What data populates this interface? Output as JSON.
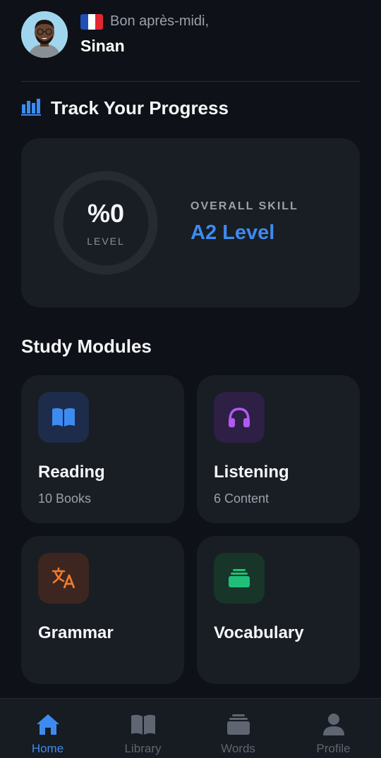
{
  "header": {
    "greeting": "Bon après-midi,",
    "username": "Sinan",
    "flag": "france-flag-icon"
  },
  "progress": {
    "title": "Track Your Progress",
    "ring_value": "%0",
    "ring_label": "LEVEL",
    "ring_percent": 0,
    "skill_label": "OVERALL SKILL",
    "skill_value": "A2 Level"
  },
  "modules": {
    "title": "Study Modules",
    "items": [
      {
        "name": "Reading",
        "subtitle": "10 Books",
        "icon": "book-icon",
        "accent": "#3d8bf0"
      },
      {
        "name": "Listening",
        "subtitle": "6 Content",
        "icon": "headphones-icon",
        "accent": "#b05af2"
      },
      {
        "name": "Grammar",
        "subtitle": "",
        "icon": "translate-icon",
        "accent": "#f07a2c"
      },
      {
        "name": "Vocabulary",
        "subtitle": "",
        "icon": "cards-stack-icon",
        "accent": "#1fbf7a"
      }
    ]
  },
  "nav": {
    "items": [
      {
        "label": "Home",
        "icon": "home-icon",
        "active": true
      },
      {
        "label": "Library",
        "icon": "book-icon",
        "active": false
      },
      {
        "label": "Words",
        "icon": "cards-stack-icon",
        "active": false
      },
      {
        "label": "Profile",
        "icon": "person-icon",
        "active": false
      }
    ]
  },
  "colors": {
    "background": "#0e1117",
    "card": "#191d24",
    "accent": "#3d8bf0",
    "muted": "#9aa1ab"
  }
}
